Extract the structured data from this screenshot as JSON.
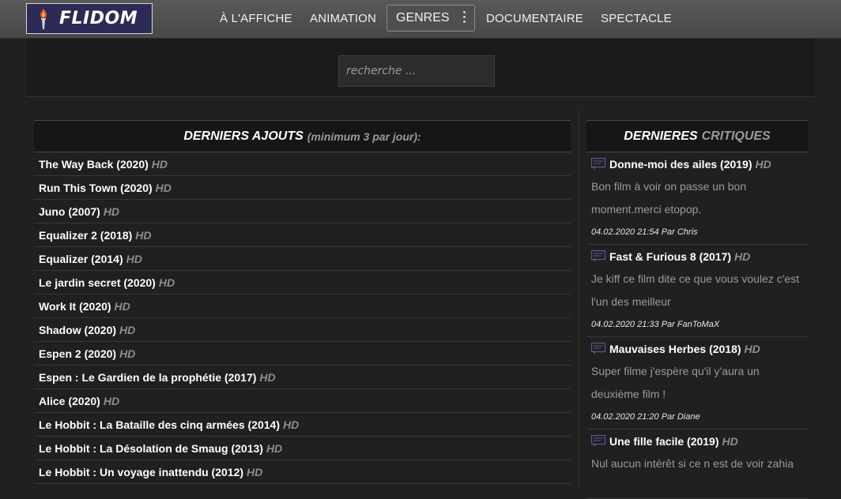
{
  "header": {
    "logo_text": "FLIDOM",
    "nav": {
      "affiche": "À L'AFFICHE",
      "animation": "ANIMATION",
      "genres": "GENRES",
      "documentaire": "DOCUMENTAIRE",
      "spectacle": "SPECTACLE"
    }
  },
  "search": {
    "placeholder": "recherche ..."
  },
  "latest": {
    "title_main": "DERNIERS AJOUTS",
    "title_note": "(minimum 3 par jour):",
    "hd_label": "HD",
    "items": [
      "The Way Back (2020)",
      "Run This Town (2020)",
      "Juno (2007)",
      "Equalizer 2 (2018)",
      "Equalizer (2014)",
      "Le jardin secret (2020)",
      "Work It (2020)",
      "Shadow (2020)",
      "Espen 2 (2020)",
      "Espen : Le Gardien de la prophétie (2017)",
      "Alice (2020)",
      "Le Hobbit : La Bataille des cinq armées (2014)",
      "Le Hobbit : La Désolation de Smaug (2013)",
      "Le Hobbit : Un voyage inattendu (2012)"
    ]
  },
  "reviews": {
    "title_main": "DERNIERES",
    "title_muted": "CRITIQUES",
    "hd_label": "HD",
    "items": [
      {
        "film": "Donne-moi des ailes (2019)",
        "text": "Bon film à voir on passe un bon moment.merci etopop.",
        "meta": "04.02.2020 21:54 Par Chris"
      },
      {
        "film": "Fast & Furious 8 (2017)",
        "text": "Je kiff ce film dite ce que vous voulez c'est l'un des meilleur",
        "meta": "04.02.2020 21:33 Par FanToMaX"
      },
      {
        "film": "Mauvaises Herbes (2018)",
        "text": "Super filme j'espère qu'il y'aura un deuxième film !",
        "meta": "04.02.2020 21:20 Par Diane"
      },
      {
        "film": "Une fille facile (2019)",
        "text": "Nul aucun intérêt si ce n est de voir zahia",
        "meta": ""
      }
    ]
  }
}
